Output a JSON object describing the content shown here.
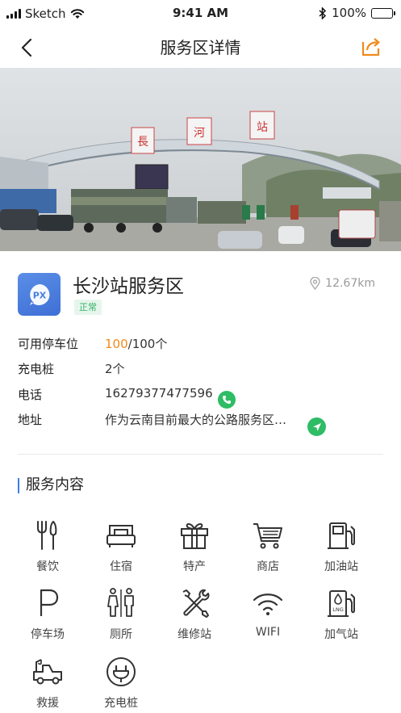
{
  "status_bar": {
    "carrier": "Sketch",
    "time": "9:41 AM",
    "battery": "100%"
  },
  "nav": {
    "title": "服务区详情"
  },
  "station": {
    "name": "长沙站服务区",
    "logo_text": "PX",
    "status": "正常",
    "distance": "12.67km",
    "parking_label": "可用停车位",
    "parking_available": "100",
    "parking_total": "/100个",
    "charger_label": "充电桩",
    "charger_value": "2个",
    "phone_label": "电话",
    "phone_value": "16279377477596",
    "address_label": "地址",
    "address_value": "作为云南目前最大的公路服务区…"
  },
  "services": {
    "title": "服务内容",
    "items": [
      {
        "label": "餐饮",
        "icon": "dining-icon"
      },
      {
        "label": "住宿",
        "icon": "bed-icon"
      },
      {
        "label": "特产",
        "icon": "gift-icon"
      },
      {
        "label": "商店",
        "icon": "cart-icon"
      },
      {
        "label": "加油站",
        "icon": "fuel-pump-icon"
      },
      {
        "label": "停车场",
        "icon": "parking-icon"
      },
      {
        "label": "厕所",
        "icon": "restroom-icon"
      },
      {
        "label": "维修站",
        "icon": "repair-tools-icon"
      },
      {
        "label": "WIFI",
        "icon": "wifi-icon"
      },
      {
        "label": "加气站",
        "icon": "lng-station-icon"
      },
      {
        "label": "救援",
        "icon": "tow-truck-icon"
      },
      {
        "label": "充电桩",
        "icon": "ev-charger-icon"
      }
    ]
  },
  "colors": {
    "accent_orange": "#f08a1c",
    "green": "#2ebc64",
    "blue_bar": "#3f7fe0",
    "logo_blue": "#4a7fe0"
  }
}
